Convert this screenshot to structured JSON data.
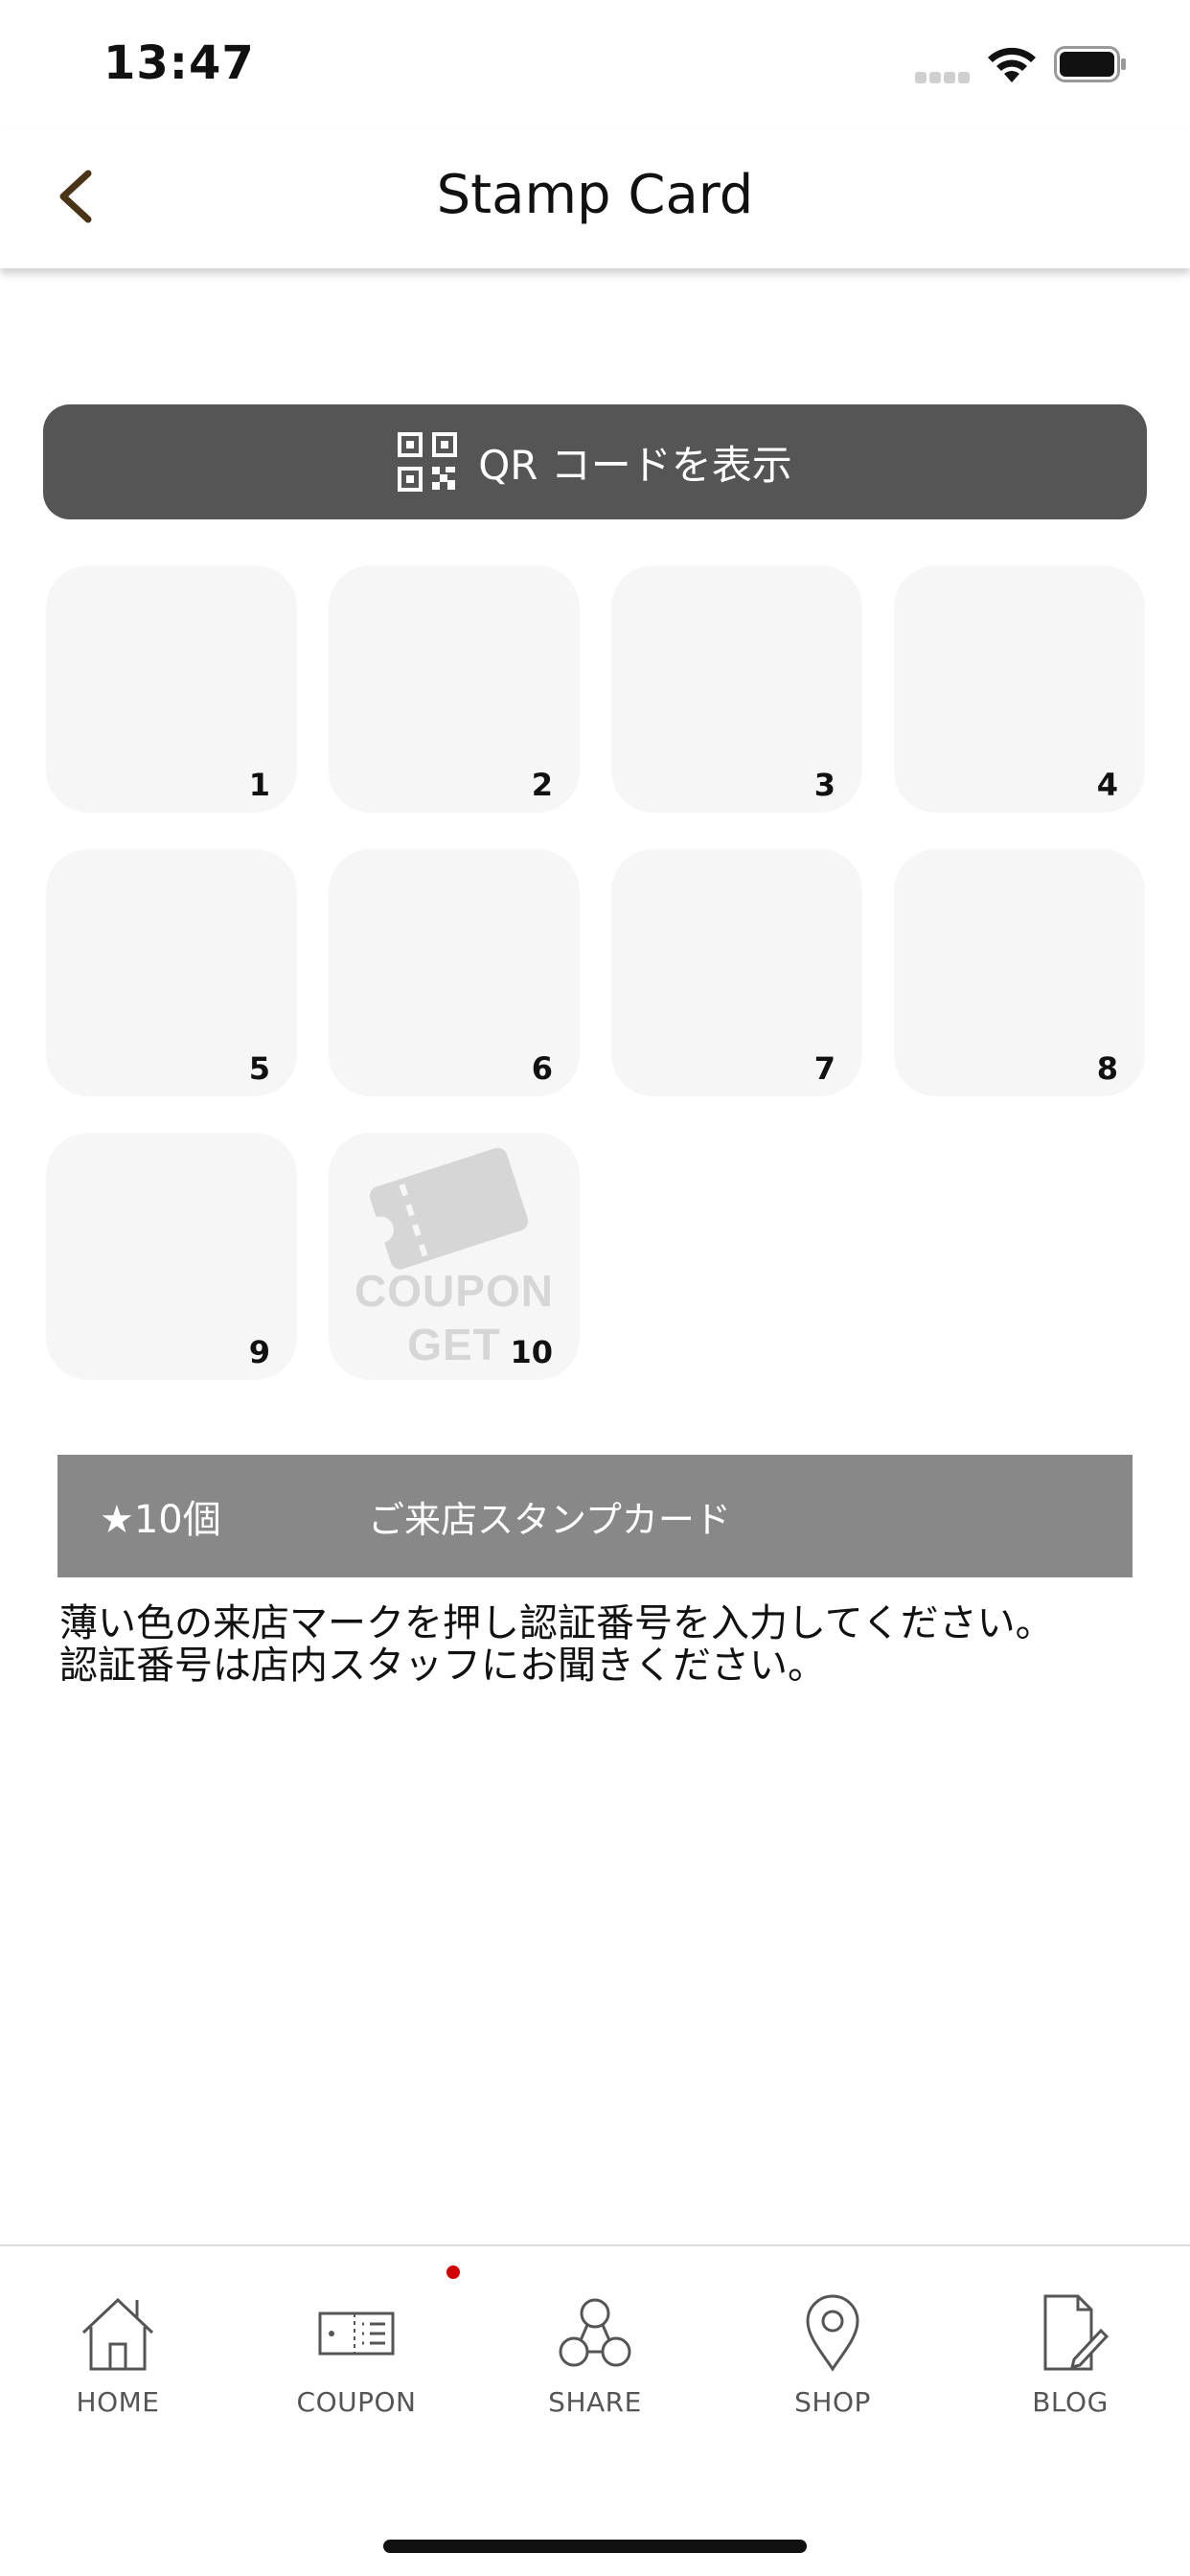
{
  "status_bar": {
    "time": "13:47"
  },
  "header": {
    "title": "Stamp Card"
  },
  "qr_button": {
    "label": "QR コードを表示"
  },
  "stamps": [
    {
      "number": "1"
    },
    {
      "number": "2"
    },
    {
      "number": "3"
    },
    {
      "number": "4"
    },
    {
      "number": "5"
    },
    {
      "number": "6"
    },
    {
      "number": "7"
    },
    {
      "number": "8"
    },
    {
      "number": "9"
    }
  ],
  "reward_stamp": {
    "number": "10",
    "line1": "COUPON",
    "line2": "GET"
  },
  "info_bar": {
    "count": "★10個",
    "title": "ご来店スタンプカード"
  },
  "instructions": {
    "line1": "薄い色の来店マークを押し認証番号を入力してください。",
    "line2": "認証番号は店内スタッフにお聞きください。"
  },
  "tab_bar": {
    "home": "HOME",
    "coupon": "COUPON",
    "share": "SHARE",
    "shop": "SHOP",
    "blog": "BLOG"
  },
  "colors": {
    "qr_button_bg": "#555555",
    "info_bar_bg": "#888888",
    "badge": "#d40000",
    "back_arrow": "#4a3418"
  }
}
